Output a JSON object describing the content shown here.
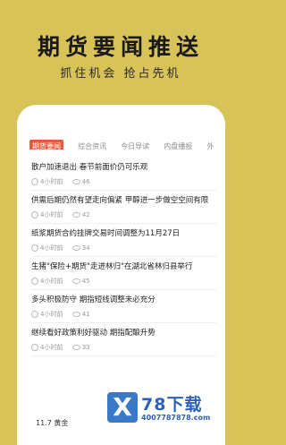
{
  "promo": {
    "title": "期货要闻推送",
    "subtitle": "抓住机会  抢占先机"
  },
  "tabs": [
    {
      "label": "期货要闻",
      "active": true
    },
    {
      "label": "综合资讯"
    },
    {
      "label": "今日导读"
    },
    {
      "label": "内盘播报"
    },
    {
      "label": "外"
    }
  ],
  "items": [
    {
      "title": "散户加速退出 春节前面价仍可乐观",
      "time": "4小时前",
      "views": "46"
    },
    {
      "title": "供需后期仍然有望走向偏紧 甲醇进一步做空空间有限",
      "time": "4小时前",
      "views": "42"
    },
    {
      "title": "纸浆期货合约挂牌交易时间调整为11月27日",
      "time": "4小时前",
      "views": "34"
    },
    {
      "title": "生猪\"保险+期货\"走进林归\"在湖北省林归县举行",
      "time": "4小时前",
      "views": "45"
    },
    {
      "title": "多头积极防守 期指短线调整未必充分",
      "time": "4小时前",
      "views": "41"
    },
    {
      "title": "继续看好政策利好驱动 期指配酿升势",
      "time": "4小时前",
      "views": "33"
    }
  ],
  "footer": {
    "partial_text": "11.7 黄金"
  },
  "watermark": {
    "name": "78下载",
    "url": "4007787878.com"
  }
}
